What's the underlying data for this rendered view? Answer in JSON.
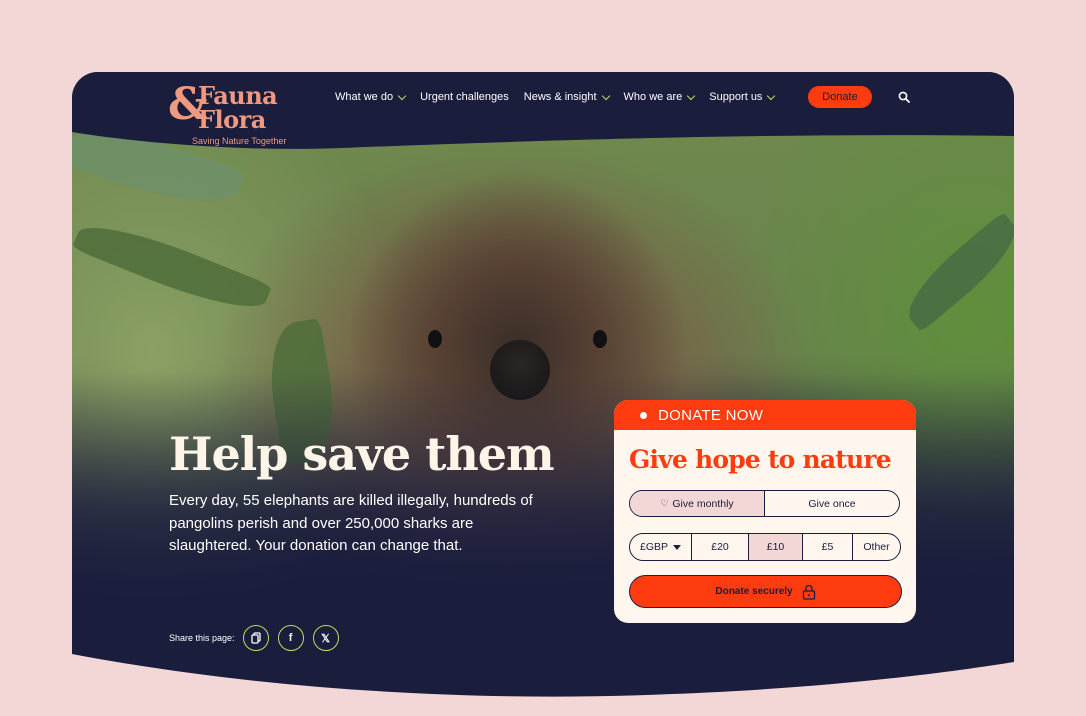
{
  "brand": {
    "amp": "&",
    "word1": "Fauna",
    "word2": "Flora",
    "tagline": "Saving Nature Together",
    "color": "#ef9a80"
  },
  "nav": {
    "items": [
      {
        "label": "What we do",
        "dropdown": true
      },
      {
        "label": "Urgent challenges",
        "dropdown": false
      },
      {
        "label": "News & insight",
        "dropdown": true
      },
      {
        "label": "Who we are",
        "dropdown": true
      },
      {
        "label": "Support us",
        "dropdown": true
      }
    ],
    "donate_label": "Donate",
    "search_icon": "search-icon"
  },
  "hero": {
    "headline": "Help save them",
    "subcopy": "Every day, 55 elephants are killed illegally, hundreds of pangolins perish and over 250,000 sharks are slaughtered. Your donation can change that.",
    "share_label": "Share this page:",
    "share_icons": [
      "copy-link-icon",
      "facebook-icon",
      "x-icon"
    ]
  },
  "donation": {
    "badge": "DONATE NOW",
    "title": "Give hope to nature",
    "frequency": {
      "options": [
        "Give monthly",
        "Give once"
      ],
      "selected": "Give monthly"
    },
    "currency": "£GBP",
    "amounts": [
      "£20",
      "£10",
      "£5",
      "Other"
    ],
    "selected_amount": "£10",
    "submit_label": "Donate securely"
  },
  "colors": {
    "navy": "#1b1d3d",
    "accent": "#ff3c0f",
    "lime": "#b8e05a",
    "cream": "#fff6ee",
    "pink": "#f2d7d6"
  }
}
